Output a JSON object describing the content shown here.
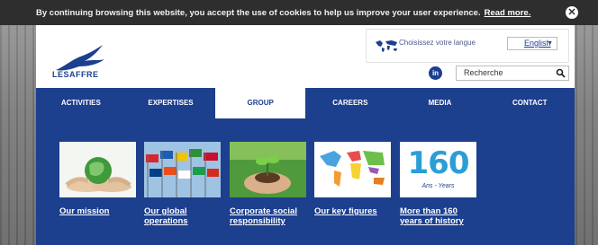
{
  "cookie_bar": {
    "message": "By continuing browsing this website, you accept the use of cookies to help us improve your user experience.",
    "read_more": "Read more.",
    "close_icon": "close-circle-icon"
  },
  "header": {
    "logo_text": "LESAFFRE",
    "language_prompt": "Choisissez votre langue",
    "language_selected": "English",
    "social_icon": "linkedin-icon",
    "social_label": "in",
    "search_placeholder": "Recherche",
    "search_icon": "magnifier-icon"
  },
  "nav": {
    "items": [
      {
        "label": "ACTIVITIES"
      },
      {
        "label": "EXPERTISES"
      },
      {
        "label": "GROUP",
        "active": true
      },
      {
        "label": "CAREERS"
      },
      {
        "label": "MEDIA"
      },
      {
        "label": "CONTACT"
      }
    ]
  },
  "group_menu": {
    "cards": [
      {
        "label": "Our mission",
        "image": "hands-holding-earth"
      },
      {
        "label": "Our global operations",
        "image": "world-flags"
      },
      {
        "label": "Corporate social responsibility",
        "image": "hands-holding-seedling"
      },
      {
        "label": "Our key figures",
        "image": "colored-world-map"
      },
      {
        "label": "More than 160 years of history",
        "image": "160-ans-years-logo"
      }
    ],
    "anniversary": {
      "number": "160",
      "caption": "Ans - Years"
    }
  },
  "colors": {
    "brand_blue": "#1c3f8e",
    "cookie_bar": "#2e2e2e"
  }
}
